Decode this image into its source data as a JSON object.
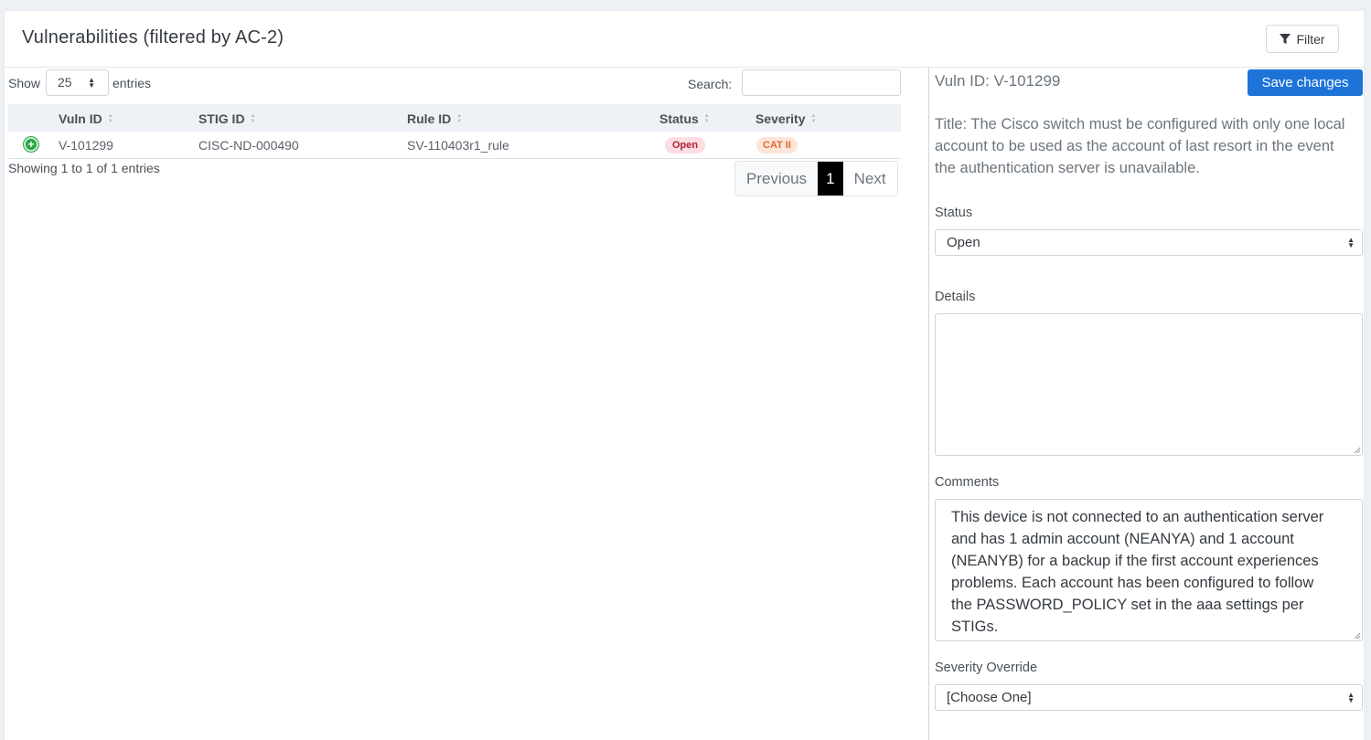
{
  "header": {
    "title": "Vulnerabilities (filtered by AC-2)",
    "filter_label": "Filter"
  },
  "table_controls": {
    "show_label": "Show",
    "page_length": "25",
    "entries_label": "entries",
    "search_label": "Search:",
    "search_value": ""
  },
  "table": {
    "columns": [
      "Vuln ID",
      "STIG ID",
      "Rule ID",
      "Status",
      "Severity"
    ],
    "rows": [
      {
        "vuln_id": "V-101299",
        "stig_id": "CISC-ND-000490",
        "rule_id": "SV-110403r1_rule",
        "status": "Open",
        "severity": "CAT II"
      }
    ],
    "info": "Showing 1 to 1 of 1 entries"
  },
  "pagination": {
    "previous": "Previous",
    "current": "1",
    "next": "Next"
  },
  "detail": {
    "vuln_id": "Vuln ID: V-101299",
    "save_label": "Save changes",
    "title": "Title: The Cisco switch must be configured with only one local account to be used as the account of last resort in the event the authentication server is unavailable.",
    "status_label": "Status",
    "status_value": "Open",
    "details_label": "Details",
    "details_value": "",
    "comments_label": "Comments",
    "comments_value": "This device is not connected to an authentication server and has 1 admin account (NEANYA) and 1 account (NEANYB) for a backup if the first account experiences problems. Each account has been configured to follow the PASSWORD_POLICY set in the aaa settings per STIGs.",
    "severity_override_label": "Severity Override",
    "severity_override_value": "[Choose One]"
  },
  "colors": {
    "primary": "#1e73d8",
    "open_badge_bg": "#fbdde2",
    "open_badge_text": "#b2213a",
    "cat_badge_bg": "#fde5d7",
    "cat_badge_text": "#e0692f",
    "expand_green": "#28a745"
  },
  "icons": [
    "filter-icon",
    "expand-row-icon",
    "sort-icon",
    "select-caret-icon"
  ]
}
